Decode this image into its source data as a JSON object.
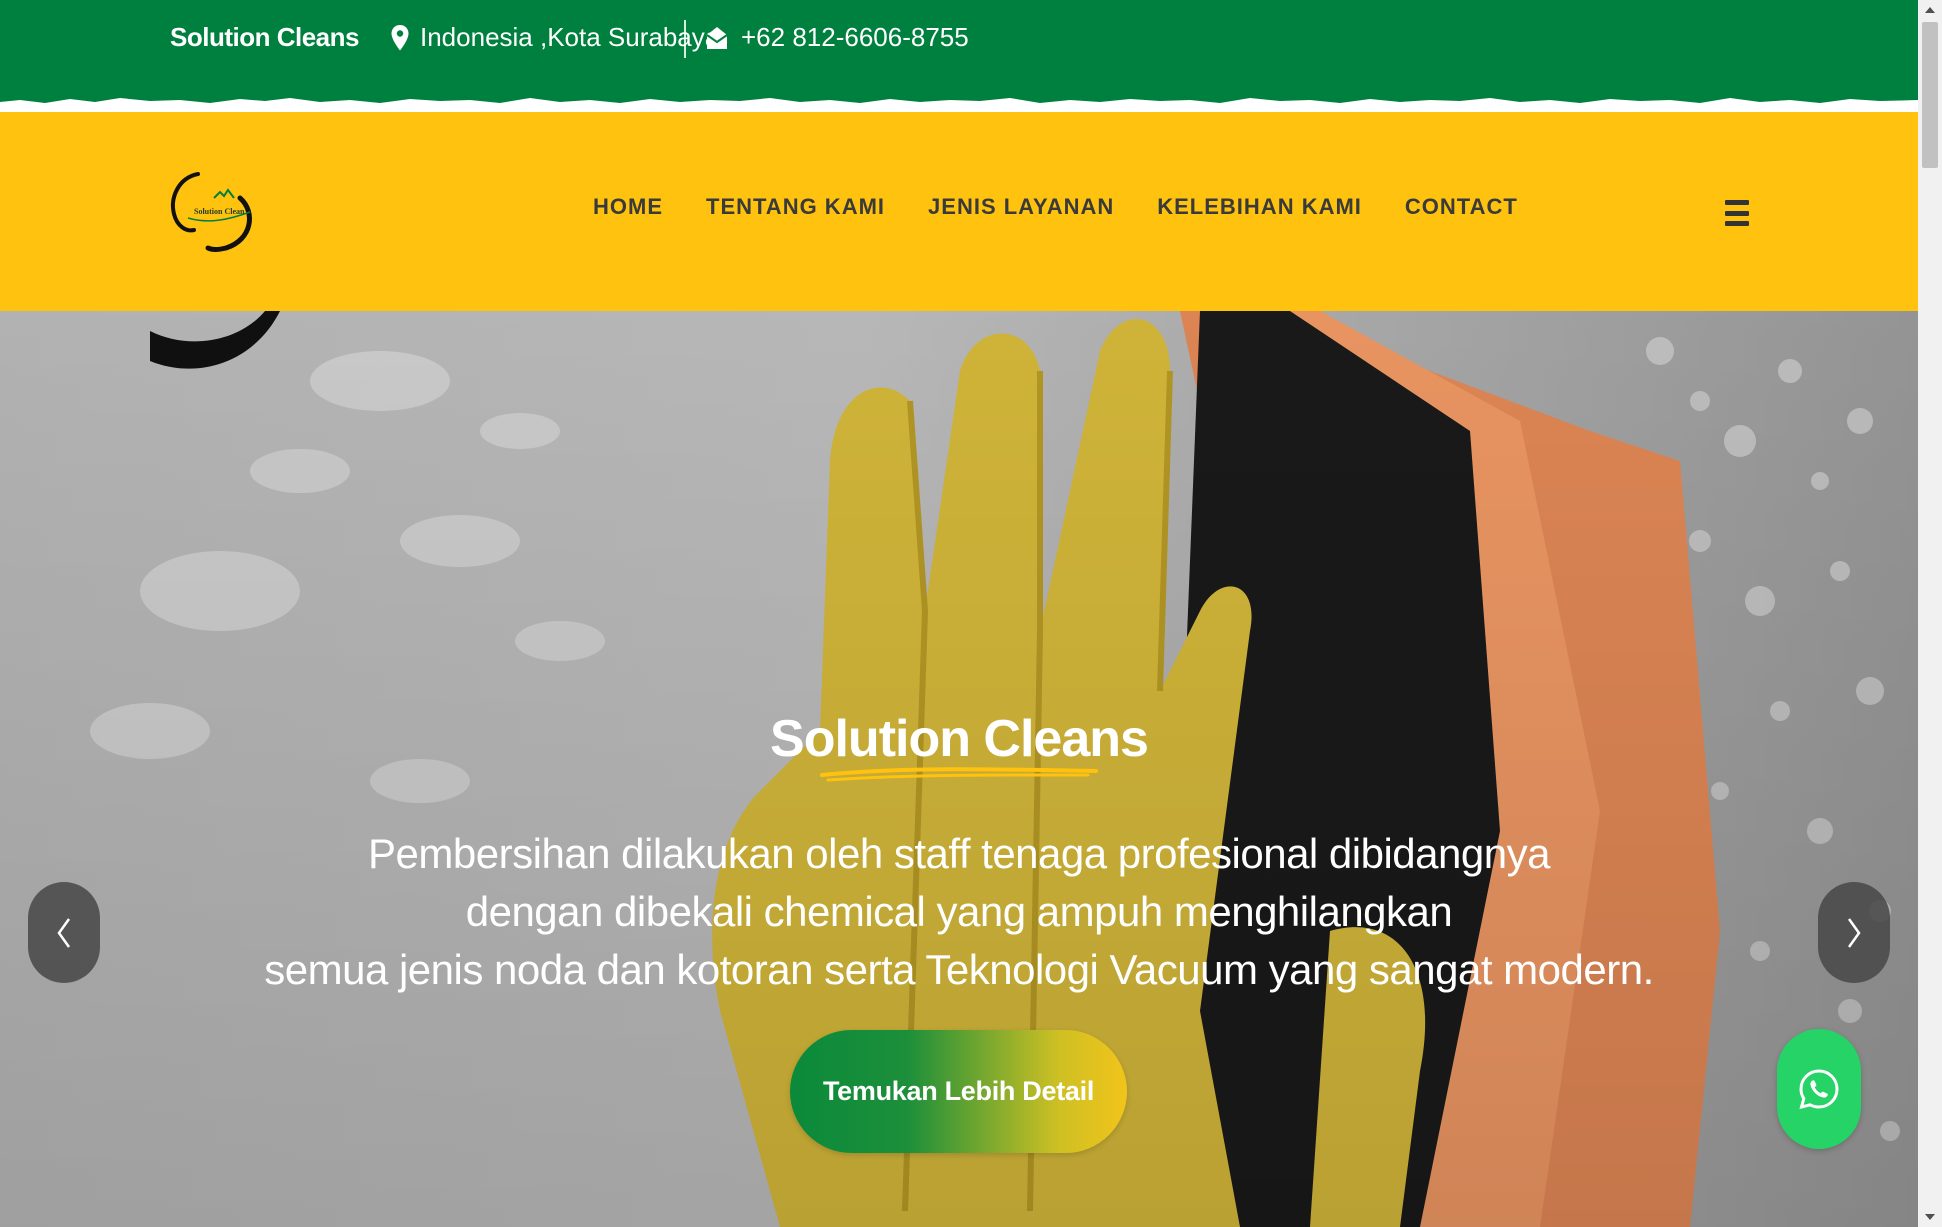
{
  "topbar": {
    "brand": "Solution Cleans",
    "location": "Indonesia ,Kota Surabaya",
    "phone": "+62 812-6606-8755",
    "location_icon": "map-pin-icon",
    "phone_icon": "envelope-icon",
    "color": "#00803e"
  },
  "nav": {
    "logo_text": "Solution Clean",
    "items": [
      {
        "label": "HOME"
      },
      {
        "label": "TENTANG KAMI"
      },
      {
        "label": "JENIS LAYANAN"
      },
      {
        "label": "KELEBIHAN KAMI"
      },
      {
        "label": "CONTACT"
      }
    ],
    "menu_icon": "hamburger-menu-icon",
    "color": "#ffc20e"
  },
  "hero": {
    "title": "Solution Cleans",
    "description": [
      "Pembersihan dilakukan oleh staff tenaga profesional dibidangnya",
      "dengan dibekali chemical yang ampuh menghilangkan",
      "semua jenis noda dan kotoran serta Teknologi Vacuum yang sangat modern."
    ],
    "cta_label": "Temukan Lebih Detail",
    "prev_icon": "chevron-left-icon",
    "next_icon": "chevron-right-icon",
    "whatsapp_icon": "whatsapp-icon",
    "whatsapp_color": "#25d366"
  }
}
